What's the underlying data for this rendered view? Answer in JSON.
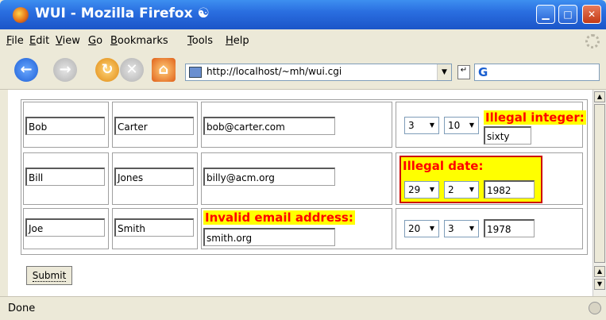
{
  "window": {
    "title": "WUI - Mozilla Firefox",
    "swirl": "☯",
    "minimize_glyph": "▁",
    "maximize_glyph": "□",
    "close_glyph": "✕"
  },
  "menu": {
    "items": [
      {
        "u": "F",
        "rest": "ile"
      },
      {
        "u": "E",
        "rest": "dit"
      },
      {
        "u": "V",
        "rest": "iew"
      },
      {
        "u": "G",
        "rest": "o"
      },
      {
        "u": "B",
        "rest": "ookmarks"
      },
      {
        "u": "T",
        "rest": "ools"
      },
      {
        "u": "H",
        "rest": "elp"
      }
    ]
  },
  "navbar": {
    "url": "http://localhost/~mh/wui.cgi",
    "icons": {
      "back": "back-icon",
      "forward": "forward-icon",
      "reload": "reload-icon",
      "stop": "stop-icon",
      "home": "home-icon"
    },
    "back_glyph": "←",
    "forward_glyph": "→",
    "reload_glyph": "↻",
    "stop_glyph": "✕",
    "home_glyph": "⌂",
    "drop_glyph": "▼",
    "go_glyph": "↵",
    "search_glyph": "G"
  },
  "form": {
    "rows": [
      {
        "first_name": "Bob",
        "last_name": "Carter",
        "email": "bob@carter.com",
        "day": "3",
        "month": "10",
        "year": "sixty",
        "error": "Illegal integer:"
      },
      {
        "first_name": "Bill",
        "last_name": "Jones",
        "email": "billy@acm.org",
        "day": "29",
        "month": "2",
        "year": "1982",
        "error": "Illegal date:"
      },
      {
        "first_name": "Joe",
        "last_name": "Smith",
        "email": "smith.org",
        "day": "20",
        "month": "3",
        "year": "1978",
        "error": "Invalid email address:"
      }
    ],
    "submit_label": "Submit",
    "select_arrow": "▼"
  },
  "status": {
    "text": "Done"
  },
  "colors": {
    "error_text": "#ff0000",
    "error_bg": "#ffff00",
    "error_border": "#cc0000"
  }
}
